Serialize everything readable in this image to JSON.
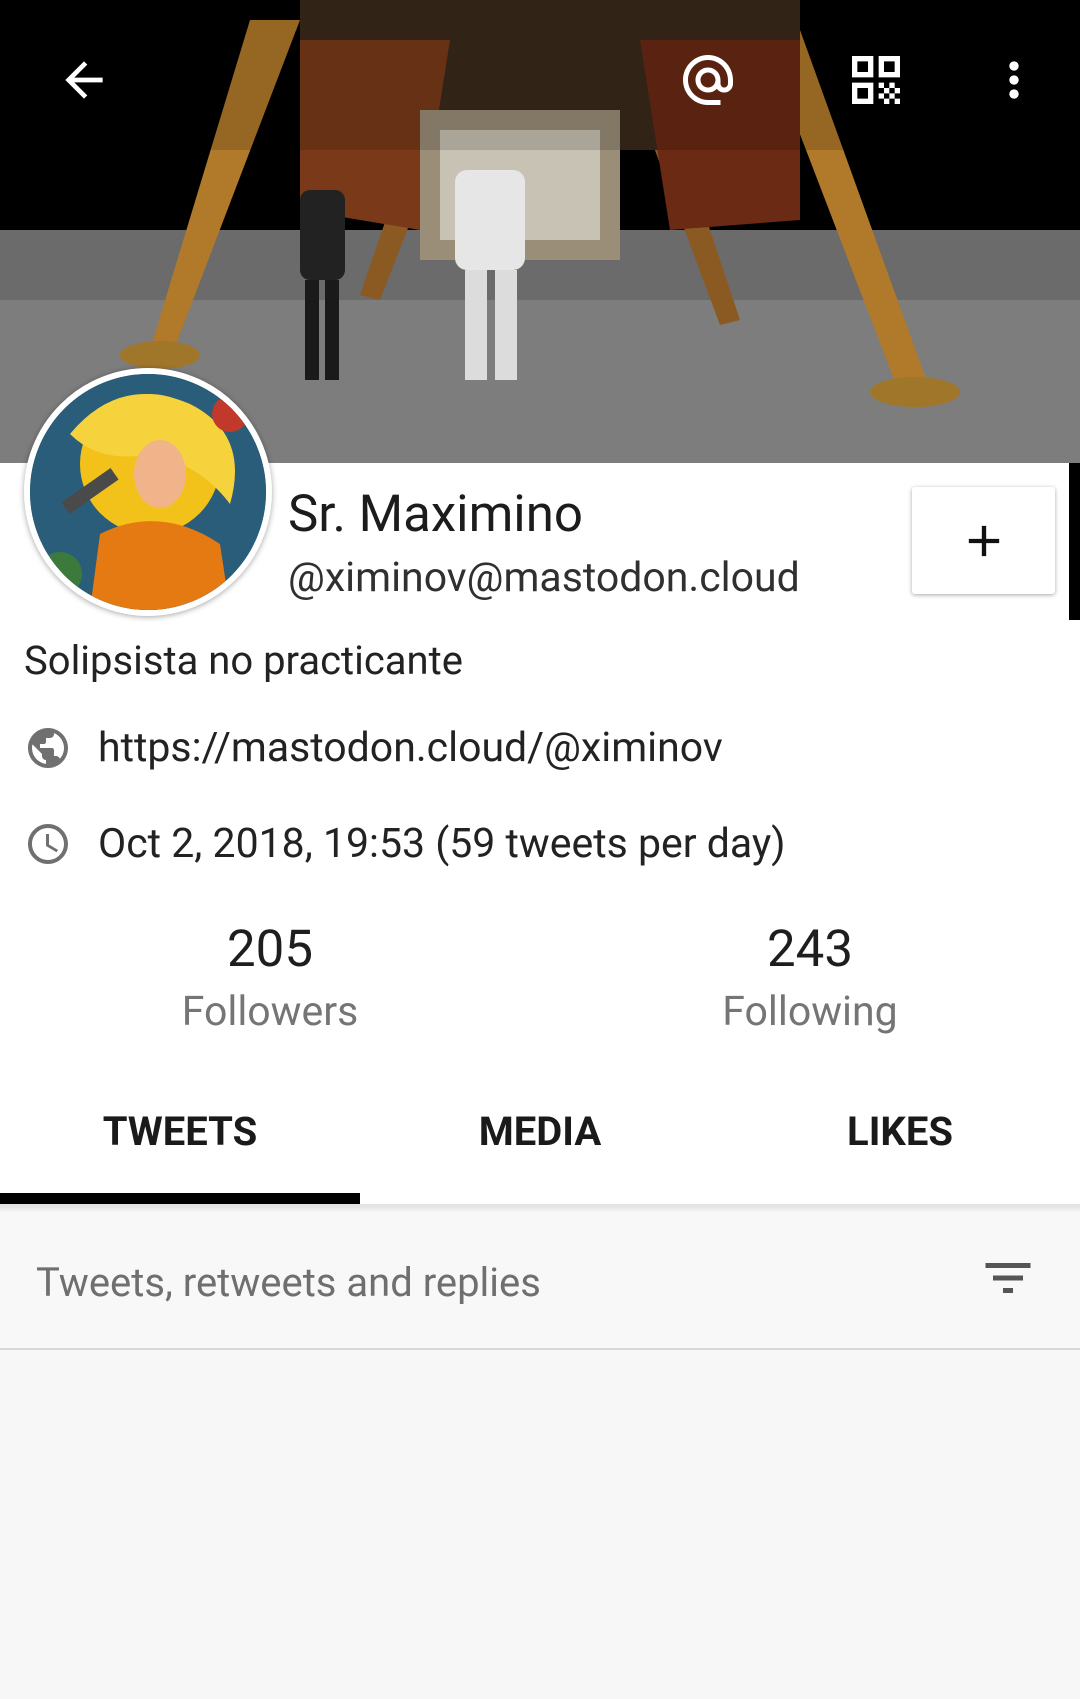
{
  "profile": {
    "display_name": "Sr. Maximino",
    "handle": "@ximinov@mastodon.cloud",
    "bio": "Solipsista no practicante",
    "website": "https://mastodon.cloud/@ximinov",
    "joined": "Oct 2, 2018, 19:53 (59 tweets per day)"
  },
  "stats": {
    "followers_count": "205",
    "followers_label": "Followers",
    "following_count": "243",
    "following_label": "Following"
  },
  "tabs": [
    {
      "label": "TWEETS",
      "active": true
    },
    {
      "label": "MEDIA",
      "active": false
    },
    {
      "label": "LIKES",
      "active": false
    }
  ],
  "filter": {
    "label": "Tweets, retweets and replies"
  },
  "icons": {
    "back": "arrow-back-icon",
    "mention": "at-sign-icon",
    "qr": "qr-code-icon",
    "menu": "more-vert-icon",
    "follow": "plus-icon",
    "website": "globe-icon",
    "joined": "clock-icon",
    "filter": "filter-list-icon"
  },
  "colors": {
    "active_tab_indicator": "#000000",
    "secondary_text": "#757575"
  }
}
